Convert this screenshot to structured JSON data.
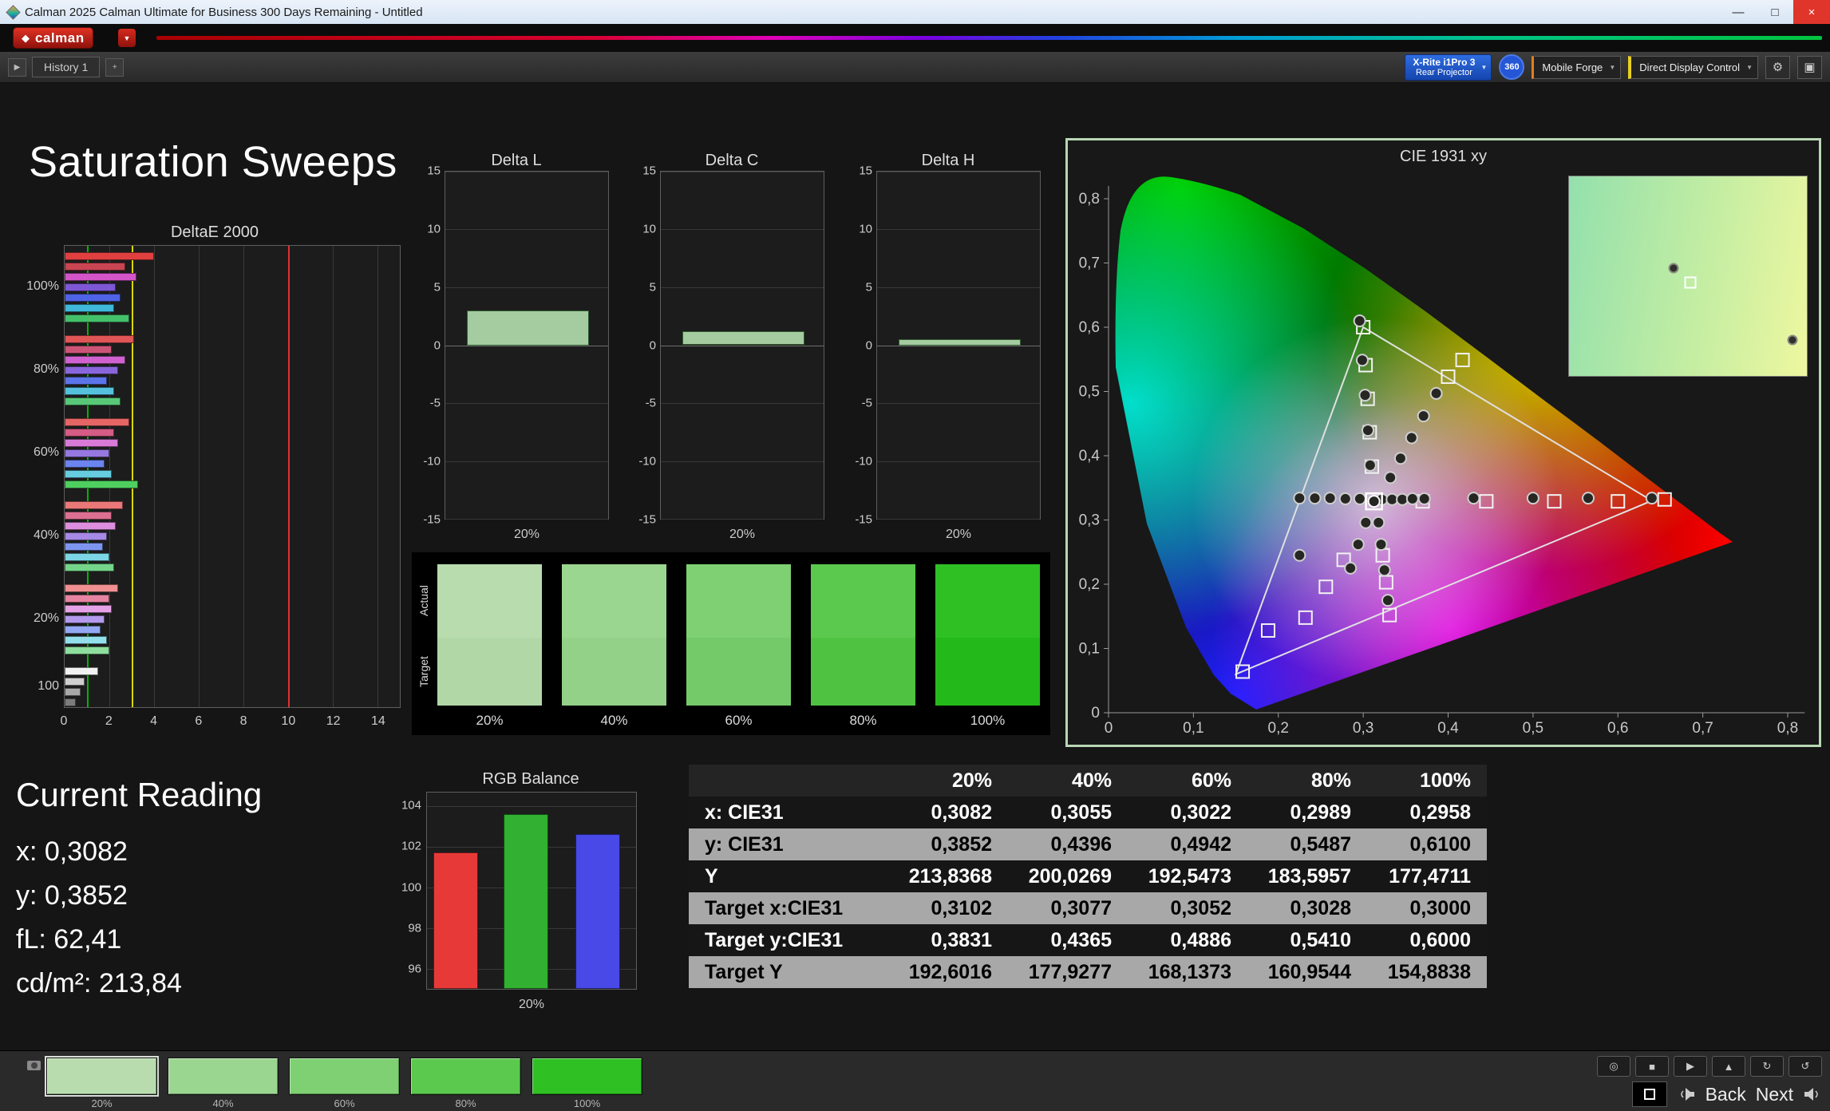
{
  "window": {
    "title": "Calman 2025 Calman Ultimate for Business 300 Days Remaining  - Untitled",
    "logo_text": "calman"
  },
  "icons": {
    "caret": "▼",
    "plus": "+",
    "panel_arrow": "▶",
    "gear": "⚙",
    "display": "▣",
    "minimize": "—",
    "maximize": "□",
    "close": "×",
    "diamond": "◆",
    "gauge": "◎",
    "stop": "■",
    "play": "▶",
    "eject": "▲",
    "refresh": "↻",
    "loop": "↺"
  },
  "toolbar": {
    "history_tab": "History 1",
    "meter_button": {
      "line1": "X-Rite i1Pro 3",
      "line2": "Rear Projector"
    },
    "badge": "360",
    "source_button": "Mobile Forge",
    "display_button": "Direct Display Control"
  },
  "page": {
    "title": "Saturation Sweeps"
  },
  "current_reading": {
    "title": "Current Reading",
    "lines": [
      "x: 0,3082",
      "y: 0,3852",
      "fL: 62,41",
      "cd/m²: 213,84"
    ]
  },
  "patches": {
    "row_labels": [
      "Actual",
      "Target"
    ],
    "columns": [
      {
        "label": "20%",
        "actual": "#b8dcae",
        "target": "#b1d7a7"
      },
      {
        "label": "40%",
        "actual": "#9bd690",
        "target": "#93d088"
      },
      {
        "label": "60%",
        "actual": "#7ed072",
        "target": "#74ca68"
      },
      {
        "label": "80%",
        "actual": "#5bc94e",
        "target": "#4fc242"
      },
      {
        "label": "100%",
        "actual": "#2fc024",
        "target": "#24b91a"
      }
    ]
  },
  "bottom_bar": {
    "selected_index": 0,
    "swatches": [
      {
        "label": "20%",
        "color": "#b8dcae"
      },
      {
        "label": "40%",
        "color": "#9bd690"
      },
      {
        "label": "60%",
        "color": "#7ed072"
      },
      {
        "label": "80%",
        "color": "#5bc94e"
      },
      {
        "label": "100%",
        "color": "#2fc024"
      }
    ],
    "back_label": "Back",
    "next_label": "Next"
  },
  "chart_data": [
    {
      "id": "deltae2000",
      "type": "bar",
      "orientation": "horizontal",
      "title": "DeltaE 2000",
      "xlim": [
        0,
        15
      ],
      "xticks": [
        0,
        2,
        4,
        6,
        8,
        10,
        12,
        14
      ],
      "reference_lines": [
        {
          "value": 1,
          "color": "#00b400"
        },
        {
          "value": 3,
          "color": "#d8d800"
        },
        {
          "value": 10,
          "color": "#e03030"
        }
      ],
      "groups": [
        {
          "label": "100%",
          "bars": [
            {
              "v": 4.0,
              "c": "#e04040"
            },
            {
              "v": 2.7,
              "c": "#c94552"
            },
            {
              "v": 3.2,
              "c": "#d455c8"
            },
            {
              "v": 2.3,
              "c": "#7e57d4"
            },
            {
              "v": 2.5,
              "c": "#4f63e6"
            },
            {
              "v": 2.2,
              "c": "#3fb8d9"
            },
            {
              "v": 2.9,
              "c": "#45c06a"
            }
          ]
        },
        {
          "label": "80%",
          "bars": [
            {
              "v": 3.1,
              "c": "#e05555"
            },
            {
              "v": 2.1,
              "c": "#cc5577"
            },
            {
              "v": 2.7,
              "c": "#cf62cf"
            },
            {
              "v": 2.4,
              "c": "#8a66dd"
            },
            {
              "v": 1.9,
              "c": "#5b74ea"
            },
            {
              "v": 2.2,
              "c": "#55c2dd"
            },
            {
              "v": 2.5,
              "c": "#58c878"
            }
          ]
        },
        {
          "label": "60%",
          "bars": [
            {
              "v": 2.9,
              "c": "#e66565"
            },
            {
              "v": 2.2,
              "c": "#d45c85"
            },
            {
              "v": 2.4,
              "c": "#d87ad8"
            },
            {
              "v": 2.0,
              "c": "#9678e0"
            },
            {
              "v": 1.8,
              "c": "#6b84ee"
            },
            {
              "v": 2.1,
              "c": "#66cce0"
            },
            {
              "v": 3.3,
              "c": "#4fcf5f"
            }
          ]
        },
        {
          "label": "40%",
          "bars": [
            {
              "v": 2.6,
              "c": "#ea7878"
            },
            {
              "v": 2.1,
              "c": "#dd7092"
            },
            {
              "v": 2.3,
              "c": "#de8ede"
            },
            {
              "v": 1.9,
              "c": "#a689e4"
            },
            {
              "v": 1.7,
              "c": "#7e95f0"
            },
            {
              "v": 2.0,
              "c": "#7cd6e6"
            },
            {
              "v": 2.2,
              "c": "#74d489"
            }
          ]
        },
        {
          "label": "20%",
          "bars": [
            {
              "v": 2.4,
              "c": "#f09090"
            },
            {
              "v": 2.0,
              "c": "#e684a2"
            },
            {
              "v": 2.1,
              "c": "#e6a2e6"
            },
            {
              "v": 1.8,
              "c": "#b49aec"
            },
            {
              "v": 1.6,
              "c": "#93a8f4"
            },
            {
              "v": 1.9,
              "c": "#93dfec"
            },
            {
              "v": 2.0,
              "c": "#8edf9e"
            }
          ]
        },
        {
          "label": "100",
          "bars": [
            {
              "v": 1.5,
              "c": "#f2f2f2"
            },
            {
              "v": 0.9,
              "c": "#cfcfcf"
            },
            {
              "v": 0.7,
              "c": "#a8a8a8"
            },
            {
              "v": 0.5,
              "c": "#7c7c7c"
            }
          ]
        }
      ]
    },
    {
      "id": "delta_l",
      "type": "bar",
      "title": "Delta L",
      "ylim": [
        -15,
        15
      ],
      "yticks": [
        15,
        10,
        5,
        0,
        -5,
        -10,
        -15
      ],
      "categories": [
        "20%"
      ],
      "values": [
        3.0
      ],
      "bar_color": "#a5cba0",
      "bar_border": "#2f5c2f"
    },
    {
      "id": "delta_c",
      "type": "bar",
      "title": "Delta C",
      "ylim": [
        -15,
        15
      ],
      "yticks": [
        15,
        10,
        5,
        0,
        -5,
        -10,
        -15
      ],
      "categories": [
        "20%"
      ],
      "values": [
        1.2
      ],
      "bar_color": "#a5cba0",
      "bar_border": "#2f5c2f"
    },
    {
      "id": "delta_h",
      "type": "bar",
      "title": "Delta H",
      "ylim": [
        -15,
        15
      ],
      "yticks": [
        15,
        10,
        5,
        0,
        -5,
        -10,
        -15
      ],
      "categories": [
        "20%"
      ],
      "values": [
        0.5
      ],
      "bar_color": "#a5cba0",
      "bar_border": "#2f5c2f"
    },
    {
      "id": "rgb_balance",
      "type": "bar",
      "title": "RGB Balance",
      "categories": [
        "Red",
        "Green",
        "Blue"
      ],
      "values": [
        101.7,
        103.6,
        102.6
      ],
      "colors": [
        "#e83939",
        "#31b031",
        "#4949e8"
      ],
      "ylim": [
        95,
        104.66
      ],
      "yticks": [
        96,
        98,
        100,
        102,
        104
      ],
      "xlabel": "20%"
    },
    {
      "id": "cie1931",
      "type": "scatter",
      "title": "CIE 1931 xy",
      "xlim": [
        0,
        0.85
      ],
      "ylim": [
        0,
        0.85
      ],
      "xticks": [
        "0",
        "0,1",
        "0,2",
        "0,3",
        "0,4",
        "0,5",
        "0,6",
        "0,7",
        "0,8"
      ],
      "yticks": [
        "0",
        "0,1",
        "0,2",
        "0,3",
        "0,4",
        "0,5",
        "0,6",
        "0,7",
        "0,8"
      ],
      "gamut_triangle": [
        [
          0.64,
          0.33
        ],
        [
          0.3,
          0.6
        ],
        [
          0.15,
          0.06
        ]
      ],
      "white_point": [
        0.3127,
        0.329
      ],
      "measured_points": [
        [
          0.3082,
          0.3852
        ],
        [
          0.3055,
          0.4396
        ],
        [
          0.3022,
          0.4942
        ],
        [
          0.2989,
          0.5487
        ],
        [
          0.2958,
          0.61
        ],
        [
          0.332,
          0.366
        ],
        [
          0.344,
          0.396
        ],
        [
          0.357,
          0.428
        ],
        [
          0.371,
          0.462
        ],
        [
          0.386,
          0.497
        ],
        [
          0.322,
          0.332
        ],
        [
          0.334,
          0.332
        ],
        [
          0.346,
          0.332
        ],
        [
          0.358,
          0.333
        ],
        [
          0.372,
          0.333
        ],
        [
          0.43,
          0.334
        ],
        [
          0.5,
          0.334
        ],
        [
          0.565,
          0.334
        ],
        [
          0.64,
          0.334
        ],
        [
          0.225,
          0.334
        ],
        [
          0.243,
          0.334
        ],
        [
          0.261,
          0.334
        ],
        [
          0.279,
          0.333
        ],
        [
          0.296,
          0.333
        ],
        [
          0.303,
          0.296
        ],
        [
          0.294,
          0.262
        ],
        [
          0.285,
          0.225
        ],
        [
          0.225,
          0.245
        ],
        [
          0.318,
          0.296
        ],
        [
          0.321,
          0.262
        ],
        [
          0.325,
          0.222
        ],
        [
          0.329,
          0.175
        ]
      ],
      "target_points": [
        [
          0.3102,
          0.3831
        ],
        [
          0.3077,
          0.4365
        ],
        [
          0.3052,
          0.4886
        ],
        [
          0.3028,
          0.541
        ],
        [
          0.3,
          0.6
        ],
        [
          0.4,
          0.523
        ],
        [
          0.417,
          0.549
        ],
        [
          0.37,
          0.329
        ],
        [
          0.445,
          0.329
        ],
        [
          0.525,
          0.329
        ],
        [
          0.6,
          0.329
        ],
        [
          0.655,
          0.332
        ],
        [
          0.277,
          0.238
        ],
        [
          0.256,
          0.196
        ],
        [
          0.232,
          0.148
        ],
        [
          0.188,
          0.128
        ],
        [
          0.158,
          0.064
        ],
        [
          0.323,
          0.245
        ],
        [
          0.327,
          0.203
        ],
        [
          0.331,
          0.152
        ]
      ],
      "inset_points": {
        "circles": [
          [
            0.44,
            0.46
          ],
          [
            0.94,
            0.82
          ]
        ],
        "squares": [
          [
            0.51,
            0.53
          ]
        ]
      }
    },
    {
      "id": "measurement_table",
      "type": "table",
      "columns": [
        "",
        "20%",
        "40%",
        "60%",
        "80%",
        "100%"
      ],
      "rows": [
        {
          "label": "x: CIE31",
          "values": [
            "0,3082",
            "0,3055",
            "0,3022",
            "0,2989",
            "0,2958"
          ]
        },
        {
          "label": "y: CIE31",
          "values": [
            "0,3852",
            "0,4396",
            "0,4942",
            "0,5487",
            "0,6100"
          ]
        },
        {
          "label": "Y",
          "values": [
            "213,8368",
            "200,0269",
            "192,5473",
            "183,5957",
            "177,4711"
          ]
        },
        {
          "label": "Target x:CIE31",
          "values": [
            "0,3102",
            "0,3077",
            "0,3052",
            "0,3028",
            "0,3000"
          ]
        },
        {
          "label": "Target y:CIE31",
          "values": [
            "0,3831",
            "0,4365",
            "0,4886",
            "0,5410",
            "0,6000"
          ]
        },
        {
          "label": "Target Y",
          "values": [
            "192,6016",
            "177,9277",
            "168,1373",
            "160,9544",
            "154,8838"
          ]
        }
      ]
    }
  ]
}
